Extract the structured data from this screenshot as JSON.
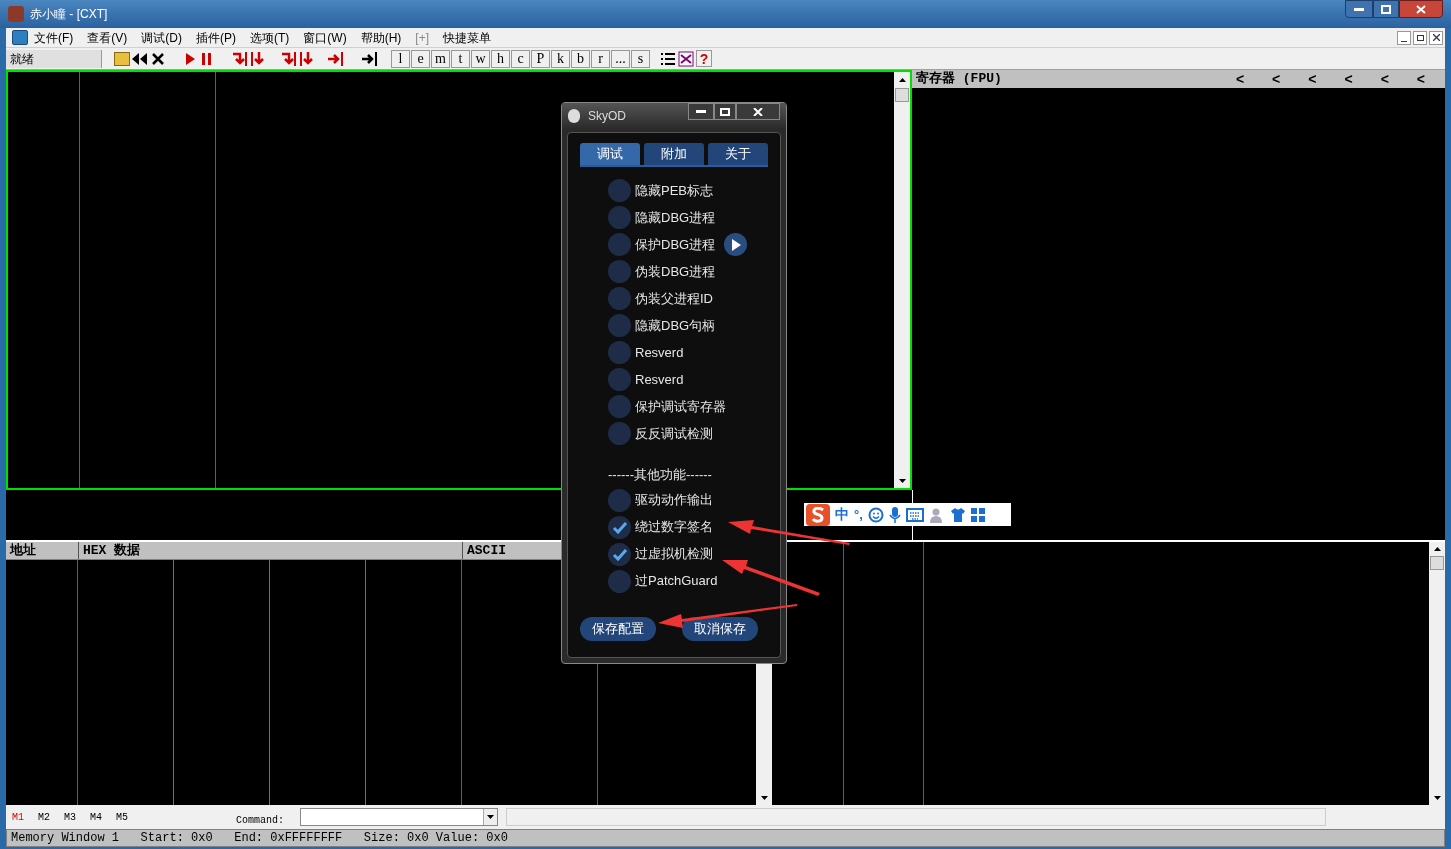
{
  "window": {
    "title": "赤小瞳 - [CXT]"
  },
  "menu": [
    {
      "label": "文件(F)",
      "disabled": false
    },
    {
      "label": "查看(V)",
      "disabled": false
    },
    {
      "label": "调试(D)",
      "disabled": false
    },
    {
      "label": "插件(P)",
      "disabled": false
    },
    {
      "label": "选项(T)",
      "disabled": false
    },
    {
      "label": "窗口(W)",
      "disabled": false
    },
    {
      "label": "帮助(H)",
      "disabled": false
    },
    {
      "label": "[+]",
      "disabled": true
    },
    {
      "label": "快捷菜单",
      "disabled": false
    }
  ],
  "toolbar": {
    "status": "就绪",
    "letter_buttons": [
      "l",
      "e",
      "m",
      "t",
      "w",
      "h",
      "c",
      "P",
      "k",
      "b",
      "r",
      "...",
      "s"
    ],
    "help": "?"
  },
  "registers": {
    "title": "寄存器 (FPU)",
    "arrows": [
      "<",
      "<",
      "<",
      "<",
      "<",
      "<"
    ]
  },
  "dump": {
    "columns": [
      "地址",
      "HEX 数据",
      "ASCII"
    ]
  },
  "memory_tabs": [
    {
      "label": "M1",
      "selected": true
    },
    {
      "label": "M2",
      "selected": false
    },
    {
      "label": "M3",
      "selected": false
    },
    {
      "label": "M4",
      "selected": false
    },
    {
      "label": "M5",
      "selected": false
    }
  ],
  "command": {
    "label": "Command:"
  },
  "status_bar": "Memory Window 1   Start: 0x0   End: 0xFFFFFFFF   Size: 0x0 Value: 0x0",
  "dialog": {
    "title": "SkyOD",
    "tabs": [
      {
        "label": "调试",
        "selected": true
      },
      {
        "label": "附加",
        "selected": false
      },
      {
        "label": "关于",
        "selected": false
      }
    ],
    "items": [
      {
        "kind": "option",
        "label": "隐藏PEB标志",
        "checked": false,
        "play_button": false
      },
      {
        "kind": "option",
        "label": "隐藏DBG进程",
        "checked": false,
        "play_button": false
      },
      {
        "kind": "option",
        "label": "保护DBG进程",
        "checked": false,
        "play_button": true
      },
      {
        "kind": "option",
        "label": "伪装DBG进程",
        "checked": false,
        "play_button": false
      },
      {
        "kind": "option",
        "label": "伪装父进程ID",
        "checked": false,
        "play_button": false
      },
      {
        "kind": "option",
        "label": "隐藏DBG句柄",
        "checked": false,
        "play_button": false
      },
      {
        "kind": "option",
        "label": "Resverd",
        "checked": false,
        "play_button": false
      },
      {
        "kind": "option",
        "label": "Resverd",
        "checked": false,
        "play_button": false
      },
      {
        "kind": "option",
        "label": "保护调试寄存器",
        "checked": false,
        "play_button": false
      },
      {
        "kind": "option",
        "label": "反反调试检测",
        "checked": false,
        "play_button": false
      },
      {
        "kind": "heading",
        "label": "------其他功能------"
      },
      {
        "kind": "option",
        "label": "驱动动作输出",
        "checked": false,
        "play_button": false
      },
      {
        "kind": "option",
        "label": "绕过数字签名",
        "checked": true,
        "play_button": false
      },
      {
        "kind": "option",
        "label": "过虚拟机检测",
        "checked": true,
        "play_button": false
      },
      {
        "kind": "option",
        "label": "过PatchGuard",
        "checked": false,
        "play_button": false
      }
    ],
    "buttons": [
      "保存配置",
      "取消保存"
    ]
  },
  "ime_toolbar": {
    "mode": "中",
    "punctuation": "°,"
  }
}
